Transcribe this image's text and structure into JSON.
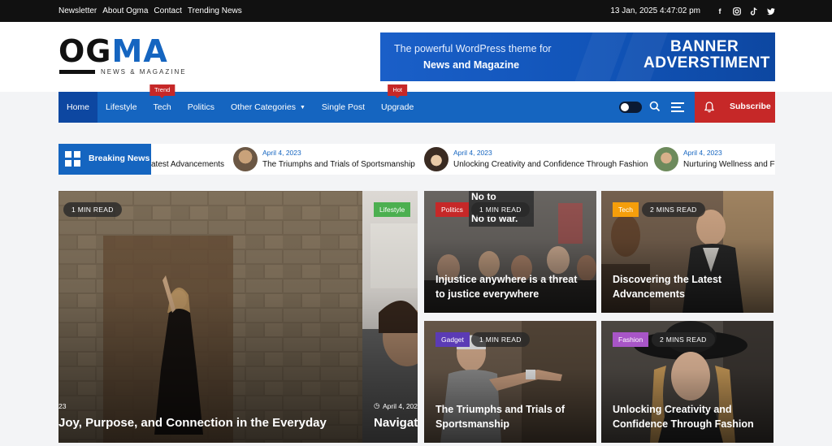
{
  "topbar": {
    "links": [
      "Newsletter",
      "About Ogma",
      "Contact",
      "Trending News"
    ],
    "datetime": "13 Jan, 2025 4:47:02 pm",
    "social": [
      {
        "icon": "facebook-icon",
        "glyph": "f"
      },
      {
        "icon": "instagram-icon",
        "glyph": "◎"
      },
      {
        "icon": "tiktok-icon",
        "glyph": "♪"
      },
      {
        "icon": "twitter-icon",
        "glyph": "🐦"
      }
    ]
  },
  "logo": {
    "text_a": "OG",
    "text_b": "MA",
    "tagline": "NEWS & MAGAZINE"
  },
  "banner": {
    "line1": "The powerful WordPress theme for",
    "line2": "News and Magazine",
    "big1": "BANNER",
    "big2": "ADVERSTIMENT"
  },
  "nav": {
    "items": [
      {
        "label": "Home",
        "active": true
      },
      {
        "label": "Lifestyle"
      },
      {
        "label": "Tech",
        "badge": "Trend"
      },
      {
        "label": "Politics"
      },
      {
        "label": "Other Categories",
        "dropdown": true
      },
      {
        "label": "Single Post"
      },
      {
        "label": "Upgrade",
        "badge": "Hot"
      }
    ],
    "subscribe": "Subscribe"
  },
  "breaking": {
    "label": "Breaking News",
    "partial": "atest Advancements",
    "items": [
      {
        "date": "April 4, 2023",
        "title": "The Triumphs and Trials of Sportsmanship"
      },
      {
        "date": "April 4, 2023",
        "title": "Unlocking Creativity and Confidence Through Fashion"
      },
      {
        "date": "April 4, 2023",
        "title": "Nurturing Wellness and Fi"
      }
    ]
  },
  "hero": {
    "read": "1 MIN READ",
    "title": "Joy, Purpose, and Connection in the Everyday",
    "meta_partial": "23",
    "side_category": "Lifestyle",
    "side_date": "April 4, 202",
    "side_title": "Navigat"
  },
  "cards": [
    {
      "category": "Politics",
      "color": "#c62828",
      "read": "1 MIN READ",
      "title": "Injustice anywhere is a threat to justice everywhere"
    },
    {
      "category": "Tech",
      "color": "#f59e0b",
      "read": "2 MINS READ",
      "title": "Discovering the Latest Advancements"
    },
    {
      "category": "Gadget",
      "color": "#5b3bb5",
      "read": "1 MIN READ",
      "title": "The Triumphs and Trials of Sportsmanship"
    },
    {
      "category": "Fashion",
      "color": "#a855c7",
      "read": "2 MINS READ",
      "title": "Unlocking Creativity and Confidence Through Fashion"
    }
  ],
  "sign_text": [
    "No to",
    "No to war."
  ],
  "colors": {
    "brand": "#1565c0",
    "accent": "#c62828",
    "lifestyle": "#4caf50"
  }
}
